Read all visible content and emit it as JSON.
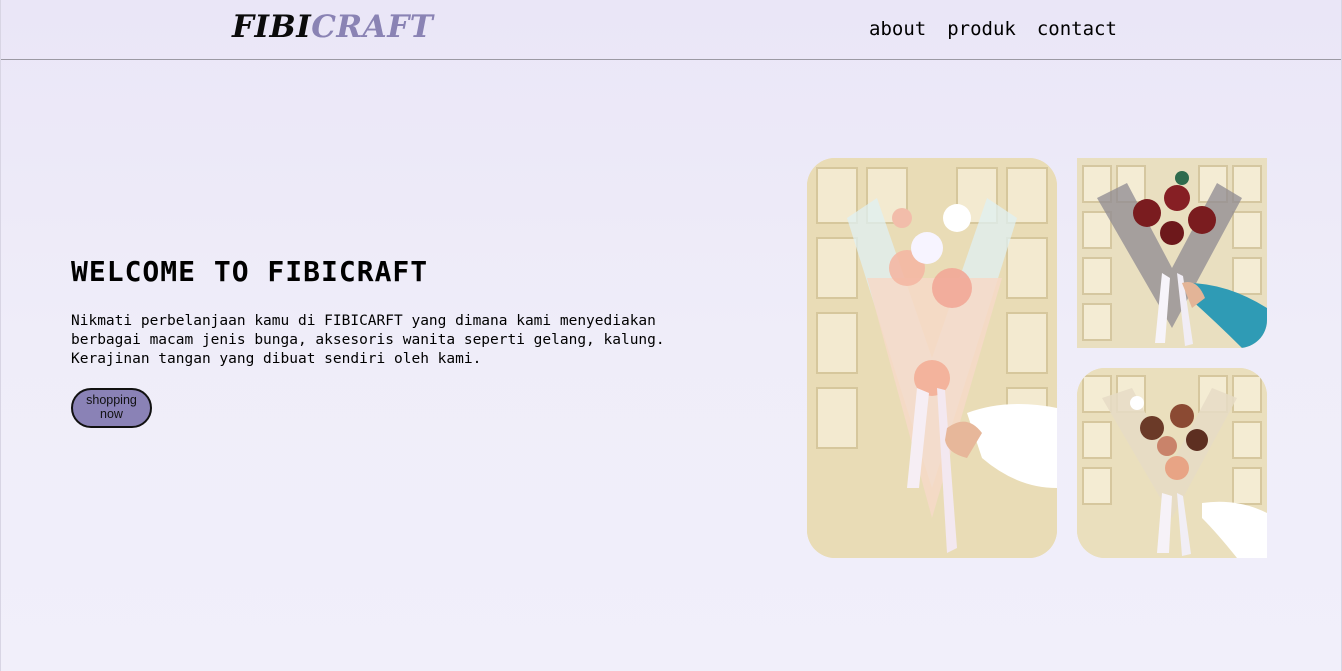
{
  "header": {
    "logo_part1": "FIBI",
    "logo_part2": "CRAFT",
    "nav": [
      "about",
      "produk",
      "contact"
    ]
  },
  "hero": {
    "title": "WELCOME TO FIBICRAFT",
    "description": "Nikmati perbelanjaan kamu di FIBICARFT yang dimana kami menyediakan berbagai macam jenis bunga, aksesoris wanita seperti gelang, kalung. Kerajinan tangan yang dibuat sendiri oleh kami.",
    "button_label": "shopping now"
  },
  "colors": {
    "accent": "#8a83b4",
    "background": "#eae6f7",
    "button": "#8a82b6"
  },
  "images": [
    "bouquet-photo-pastel",
    "bouquet-photo-red-lilies",
    "bouquet-photo-brown-flowers"
  ]
}
